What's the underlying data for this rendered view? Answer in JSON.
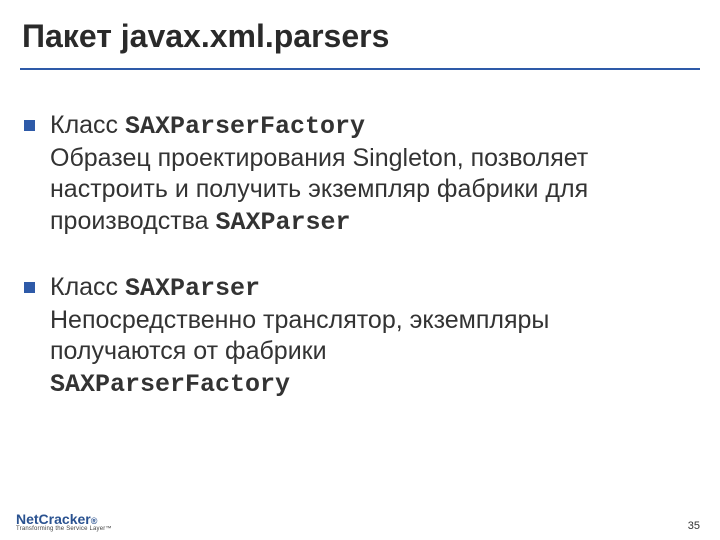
{
  "title": "Пакет javax.xml.parsers",
  "items": [
    {
      "prefix": "Класс ",
      "class_name": "SAXParserFactory",
      "desc_before": "Образец проектирования Singleton, позволяет настроить и получить экземпляр фабрики для производства ",
      "desc_code": "SAXParser",
      "desc_after": ""
    },
    {
      "prefix": "Класс ",
      "class_name": "SAXParser",
      "desc_before": "Непосредственно транслятор, экземпляры получаются от фабрики ",
      "desc_code": "SAXParserFactory",
      "desc_after": ""
    }
  ],
  "logo": {
    "name": "NetCracker",
    "tagline": "Transforming the Service Layer™"
  },
  "page_number": "35"
}
